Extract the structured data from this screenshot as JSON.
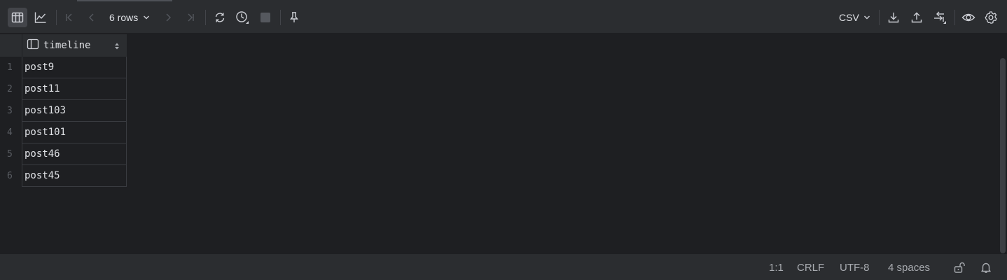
{
  "toolbar": {
    "rows_label": "6 rows",
    "format_label": "CSV",
    "icons": [
      "table-view-icon",
      "chart-view-icon",
      "first-page-icon",
      "previous-page-icon",
      "next-page-icon",
      "last-page-icon",
      "reload-icon",
      "history-icon",
      "stop-icon",
      "pin-icon",
      "export-download-icon",
      "import-upload-icon",
      "compare-icon",
      "view-eye-icon",
      "settings-gear-icon"
    ]
  },
  "grid": {
    "column": "timeline",
    "rows": [
      {
        "n": "1",
        "value": "post9"
      },
      {
        "n": "2",
        "value": "post11"
      },
      {
        "n": "3",
        "value": "post103"
      },
      {
        "n": "4",
        "value": "post101"
      },
      {
        "n": "5",
        "value": "post46"
      },
      {
        "n": "6",
        "value": "post45"
      }
    ]
  },
  "statusbar": {
    "position": "1:1",
    "line_ending": "CRLF",
    "encoding": "UTF-8",
    "indent": "4 spaces",
    "icons": [
      "lock-icon",
      "notifications-bell-icon"
    ]
  },
  "colors": {
    "background": "#1e1f22",
    "toolbar": "#2b2d30",
    "text": "#dfe1e5",
    "muted": "#a8abb0"
  }
}
